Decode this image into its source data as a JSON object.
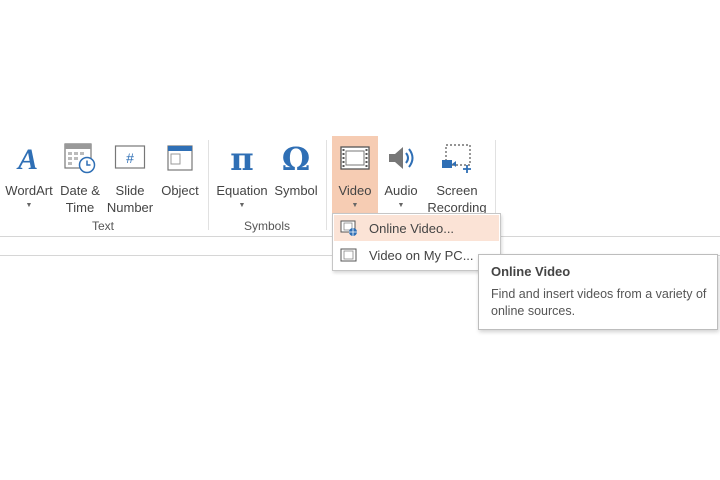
{
  "ribbon": {
    "groups": {
      "text": {
        "label": "Text"
      },
      "symbols": {
        "label": "Symbols"
      }
    },
    "buttons": {
      "wordart": {
        "line1": "WordArt",
        "line2": "",
        "icon": "wordart-icon"
      },
      "datetime": {
        "line1": "Date &",
        "line2": "Time",
        "icon": "calendar-clock-icon"
      },
      "slidenumber": {
        "line1": "Slide",
        "line2": "Number",
        "icon": "slide-number-icon"
      },
      "object": {
        "line1": "Object",
        "line2": "",
        "icon": "object-icon"
      },
      "equation": {
        "line1": "Equation",
        "line2": "",
        "icon": "pi-icon"
      },
      "symbol": {
        "line1": "Symbol",
        "line2": "",
        "icon": "omega-icon"
      },
      "video": {
        "line1": "Video",
        "line2": "",
        "icon": "film-icon"
      },
      "audio": {
        "line1": "Audio",
        "line2": "",
        "icon": "speaker-icon"
      },
      "screenrecording": {
        "line1": "Screen",
        "line2": "Recording",
        "icon": "screen-recording-icon"
      }
    }
  },
  "video_menu": {
    "items": [
      {
        "label": "Online Video...",
        "icon": "online-video-icon"
      },
      {
        "label": "Video on My PC...",
        "icon": "video-pc-icon"
      }
    ]
  },
  "tooltip": {
    "title": "Online Video",
    "body": "Find and insert videos from a variety of online sources."
  },
  "colors": {
    "accent_blue": "#2f6fb5",
    "active_button": "#f6ccb3",
    "menu_hover": "#fbe3d6"
  }
}
